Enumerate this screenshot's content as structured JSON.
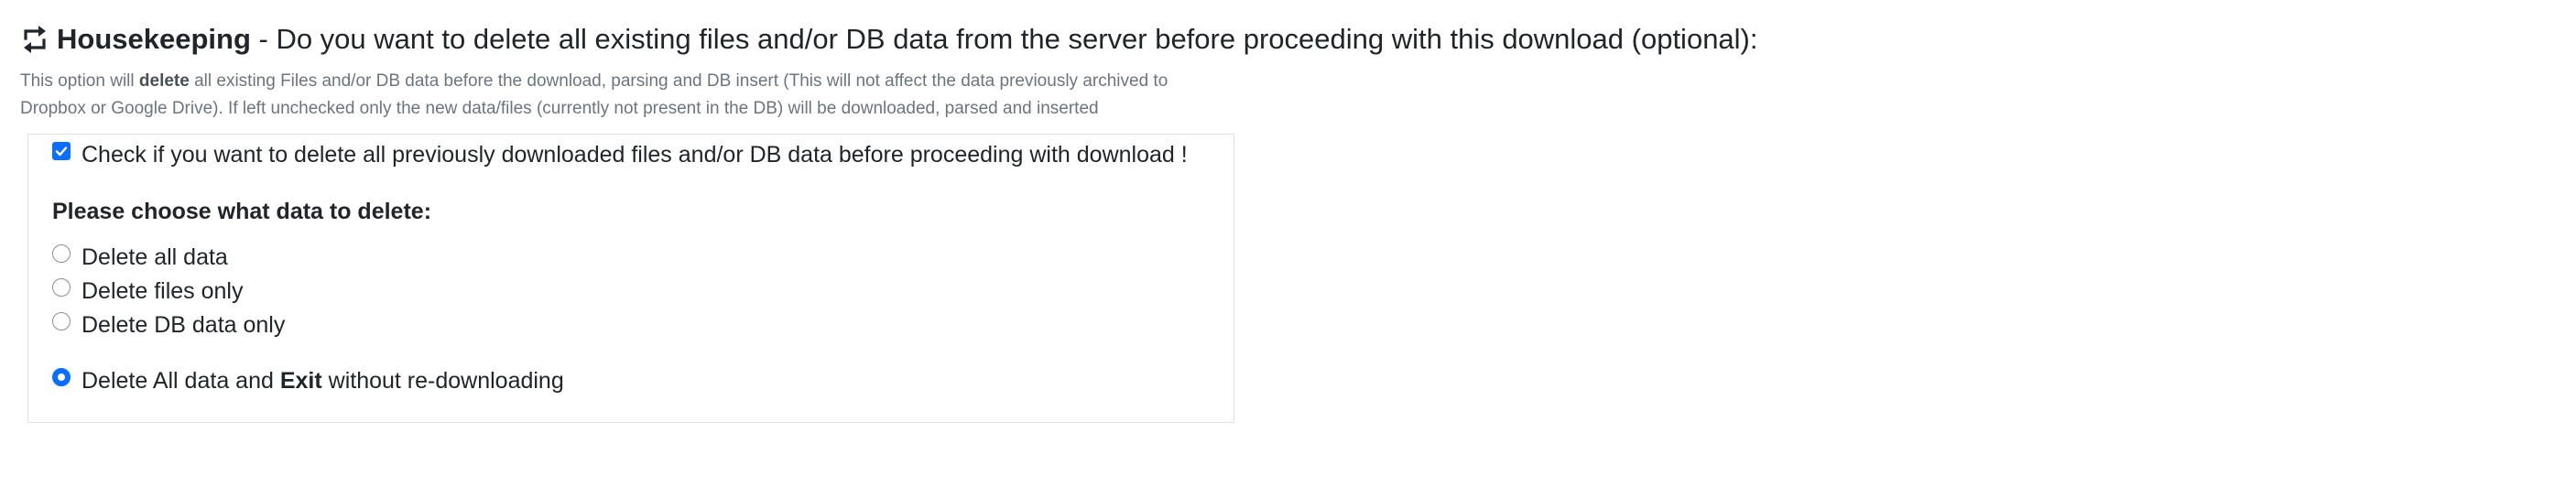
{
  "heading": {
    "icon": "repeat-arrows-icon",
    "title_bold": "Housekeeping",
    "title_rest": " - Do you want to delete all existing files and/or DB data from the server before proceeding with this download (optional):"
  },
  "description": {
    "prefix": "This option will ",
    "bold": "delete",
    "suffix": " all existing Files and/or DB data before the download, parsing and DB insert (This will not affect the data previously archived to Dropbox or Google Drive). If left unchecked only the new data/files (currently not present in the DB) will be downloaded, parsed and inserted"
  },
  "confirm": {
    "checked": true,
    "label": "Check if you want to delete all previously downloaded files and/or DB data before proceeding with download !"
  },
  "choose_heading": "Please choose what data to delete:",
  "options": [
    {
      "label": "Delete all data",
      "checked": false
    },
    {
      "label": "Delete files only",
      "checked": false
    },
    {
      "label": "Delete DB data only",
      "checked": false
    }
  ],
  "exit_option": {
    "prefix": "Delete All data and ",
    "bold": "Exit",
    "suffix": " without re-downloading",
    "checked": true
  },
  "colors": {
    "accent": "#0d6efd",
    "muted_text": "#6c757d",
    "text": "#212529",
    "border": "#dee2e6"
  }
}
